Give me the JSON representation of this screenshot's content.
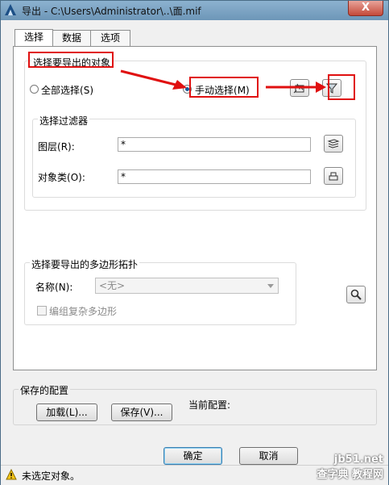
{
  "window": {
    "title": "导出 - C:\\Users\\Administrator\\..\\面.mif",
    "close_glyph": "X"
  },
  "tabs": [
    {
      "label": "选择"
    },
    {
      "label": "数据"
    },
    {
      "label": "选项"
    }
  ],
  "select_group": {
    "title": "选择要导出的对象",
    "select_all_label": "全部选择",
    "select_all_key": "(S)",
    "manual_select_label": "手动选择",
    "manual_select_key": "(M)",
    "filter_group": {
      "title": "选择过滤器",
      "layer_label": "图层",
      "layer_key": "(R)",
      "layer_suffix": ":",
      "layer_value": "*",
      "objclass_label": "对象类",
      "objclass_key": "(O)",
      "objclass_suffix": ":",
      "objclass_value": "*"
    }
  },
  "topology_group": {
    "title": "选择要导出的多边形拓扑",
    "name_label": "名称",
    "name_key": "(N)",
    "name_suffix": ":",
    "name_value": "<无>",
    "complex_polygon_label": "编组复杂多边形"
  },
  "saved_config": {
    "title": "保存的配置",
    "load_button": "加载(L)...",
    "save_button": "保存(V)...",
    "current_config_label": "当前配置:"
  },
  "buttons": {
    "ok": "确定",
    "cancel": "取消"
  },
  "status": {
    "message": "未选定对象。"
  },
  "watermark": {
    "line1": "jb51.net",
    "line2": "查字典 教程网"
  }
}
